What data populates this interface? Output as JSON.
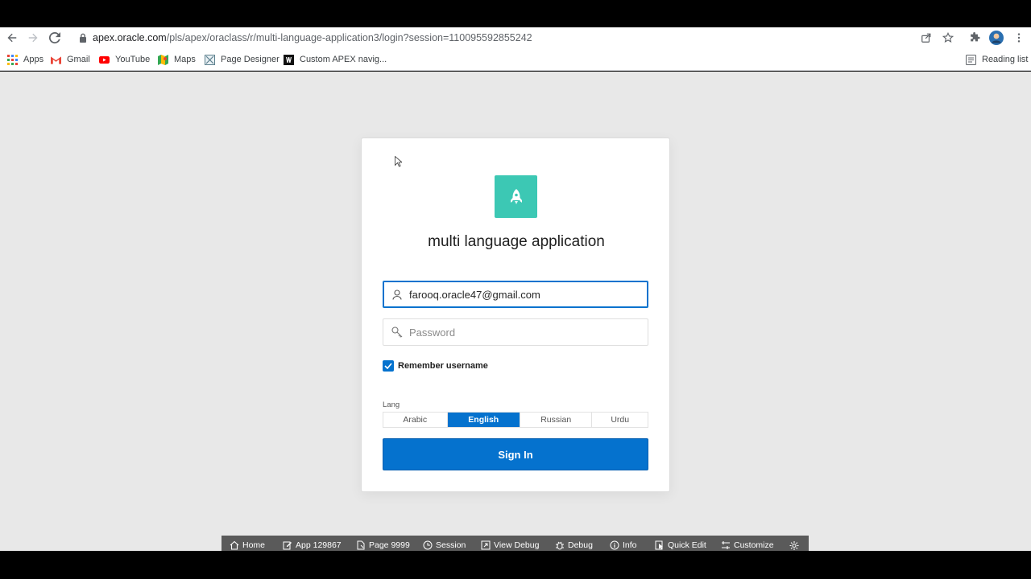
{
  "browser": {
    "url_host": "apex.oracle.com",
    "url_path": "/pls/apex/oraclass/r/multi-language-application3/login?session=110095592855242",
    "bookmarks": [
      {
        "label": "Apps",
        "icon": "apps-grid-icon"
      },
      {
        "label": "Gmail",
        "icon": "gmail-icon"
      },
      {
        "label": "YouTube",
        "icon": "youtube-icon"
      },
      {
        "label": "Maps",
        "icon": "maps-icon"
      },
      {
        "label": "Page Designer",
        "icon": "page-designer-icon"
      },
      {
        "label": "Custom APEX navig...",
        "icon": "bookmark-site-icon"
      }
    ],
    "reading_list": "Reading list"
  },
  "login": {
    "app_title": "multi language application",
    "username_value": "farooq.oracle47@gmail.com",
    "password_placeholder": "Password",
    "remember_label": "Remember username",
    "remember_checked": true,
    "lang_label": "Lang",
    "languages": [
      "Arabic",
      "English",
      "Russian",
      "Urdu"
    ],
    "selected_language": "English",
    "sign_in_label": "Sign In"
  },
  "devbar": {
    "items": [
      {
        "label": "Home",
        "icon": "home-icon"
      },
      {
        "label": "App 129867",
        "icon": "edit-icon"
      },
      {
        "label": "Page 9999",
        "icon": "page-icon"
      },
      {
        "label": "Session",
        "icon": "session-icon"
      },
      {
        "label": "View Debug",
        "icon": "view-debug-icon"
      },
      {
        "label": "Debug",
        "icon": "debug-icon"
      },
      {
        "label": "Info",
        "icon": "info-icon"
      },
      {
        "label": "Quick Edit",
        "icon": "quick-edit-icon"
      },
      {
        "label": "Customize",
        "icon": "customize-icon"
      }
    ]
  },
  "colors": {
    "primary": "#0572ce",
    "logo_bg": "#3cc8b4",
    "page_bg": "#e8e8e8",
    "devbar_bg": "#5a5a5a"
  }
}
